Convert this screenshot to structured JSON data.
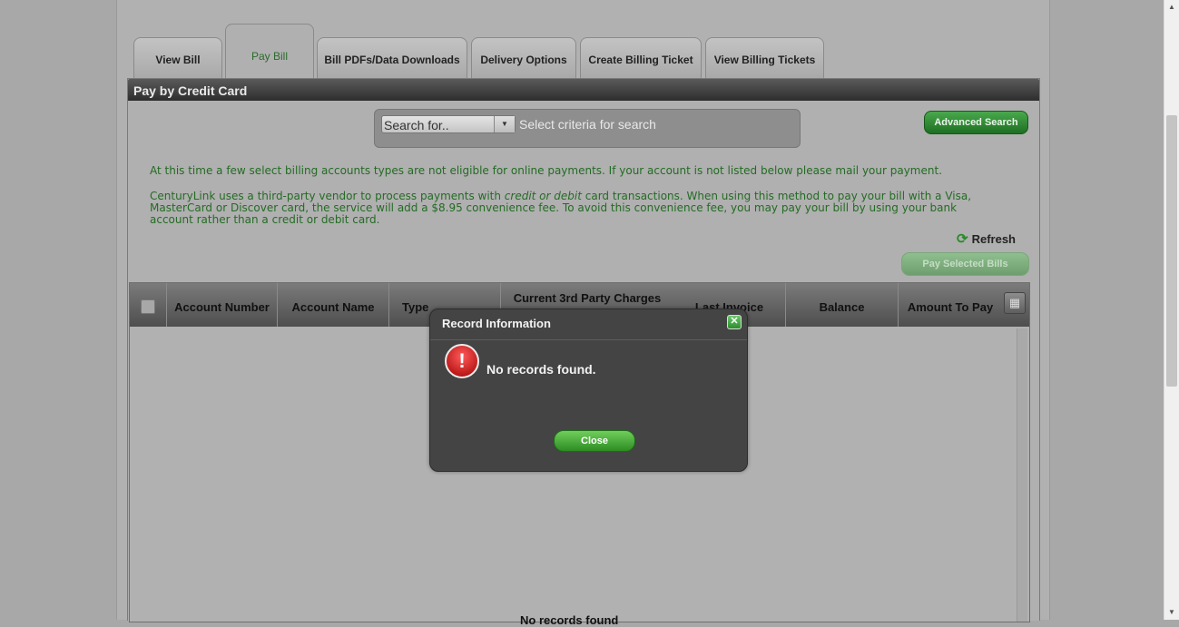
{
  "tabs": [
    {
      "label": "View Bill",
      "active": false
    },
    {
      "label": "Pay Bill",
      "active": true
    },
    {
      "label": "Bill PDFs/Data Downloads",
      "active": false
    },
    {
      "label": "Delivery Options",
      "active": false
    },
    {
      "label": "Create Billing Ticket",
      "active": false
    },
    {
      "label": "View Billing Tickets",
      "active": false
    }
  ],
  "panel": {
    "title": "Pay by Credit Card",
    "search": {
      "selected": "Search for..",
      "placeholder": "Select criteria for search"
    },
    "advanced_search_label": "Advanced Search",
    "notice_1": "At this time a few select billing accounts types are not eligible for online payments. If your account is not listed below please mail your payment.",
    "notice_2_pre": "CenturyLink uses a third-party vendor to process payments with ",
    "notice_2_em": "credit or debit",
    "notice_2_post": " card transactions. When using this method to pay your bill with a Visa, MasterCard or Discover card, the service will add a $8.95 convenience fee. To avoid this convenience fee, you may pay your bill by using your bank account rather than a credit or debit card.",
    "refresh_label": "Refresh",
    "pay_selected_label": "Pay Selected Bills"
  },
  "grid": {
    "columns": [
      "Account Number",
      "Account Name",
      "Type",
      "Last Invoice",
      "Balance",
      "Amount To Pay"
    ],
    "group_header": "Current 3rd Party Charges",
    "empty_text": "No records found"
  },
  "modal": {
    "title": "Record Information",
    "message": "No records found.",
    "close_label": "Close"
  },
  "colors": {
    "accent_green": "#1e6e22",
    "notice_text": "#246b24",
    "header_dark": "#2e2e2e",
    "alert_red": "#a30000"
  }
}
